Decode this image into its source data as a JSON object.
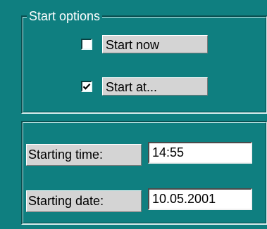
{
  "start_options": {
    "legend": "Start options",
    "items": [
      {
        "label": "Start now",
        "checked": false
      },
      {
        "label": "Start at...",
        "checked": true
      }
    ]
  },
  "schedule": {
    "time_label": "Starting time:",
    "time_value": "14:55",
    "date_label": "Starting date:",
    "date_value": "10.05.2001"
  }
}
